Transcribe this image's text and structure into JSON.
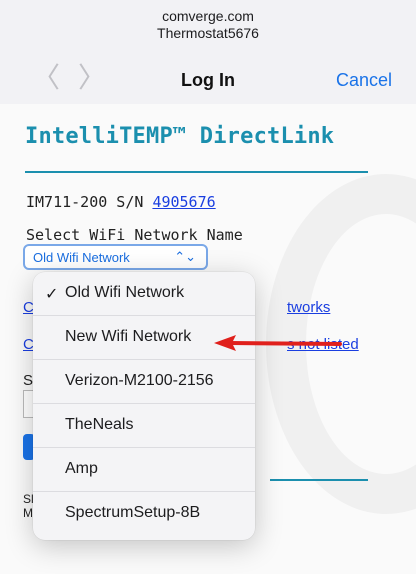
{
  "browser": {
    "domain": "comverge.com",
    "page_title": "Thermostat5676",
    "back_icon": "chevron-left-icon",
    "forward_icon": "chevron-right-icon",
    "nav_title": "Log In",
    "cancel_label": "Cancel",
    "accent": "#1a73e8"
  },
  "page": {
    "brand": "IntelliTEMP™ DirectLink",
    "brand_color": "#1b8fae",
    "model_prefix": "IM711-200 S/N ",
    "serial": "4905676",
    "select_label": "Select WiFi Network Name",
    "selected_network": "Old Wifi Network",
    "link1_left": "C",
    "link1_right": "tworks",
    "link2_left": "C",
    "link2_right": "s not listed",
    "field_label": "S",
    "footer_line1": "Sl",
    "footer_line2": "M."
  },
  "dropdown": {
    "options": [
      {
        "label": "Old Wifi Network",
        "checkmark": "✓",
        "selected": true
      },
      {
        "label": "New Wifi Network",
        "selected": false
      },
      {
        "label": "Verizon-M2100-2156",
        "selected": false
      },
      {
        "label": "TheNeals",
        "selected": false
      },
      {
        "label": "Amp",
        "selected": false
      },
      {
        "label": "SpectrumSetup-8B",
        "selected": false
      }
    ]
  },
  "annotation": {
    "arrow_color": "#e0201c",
    "arrow_icon": "red-arrow-icon"
  }
}
